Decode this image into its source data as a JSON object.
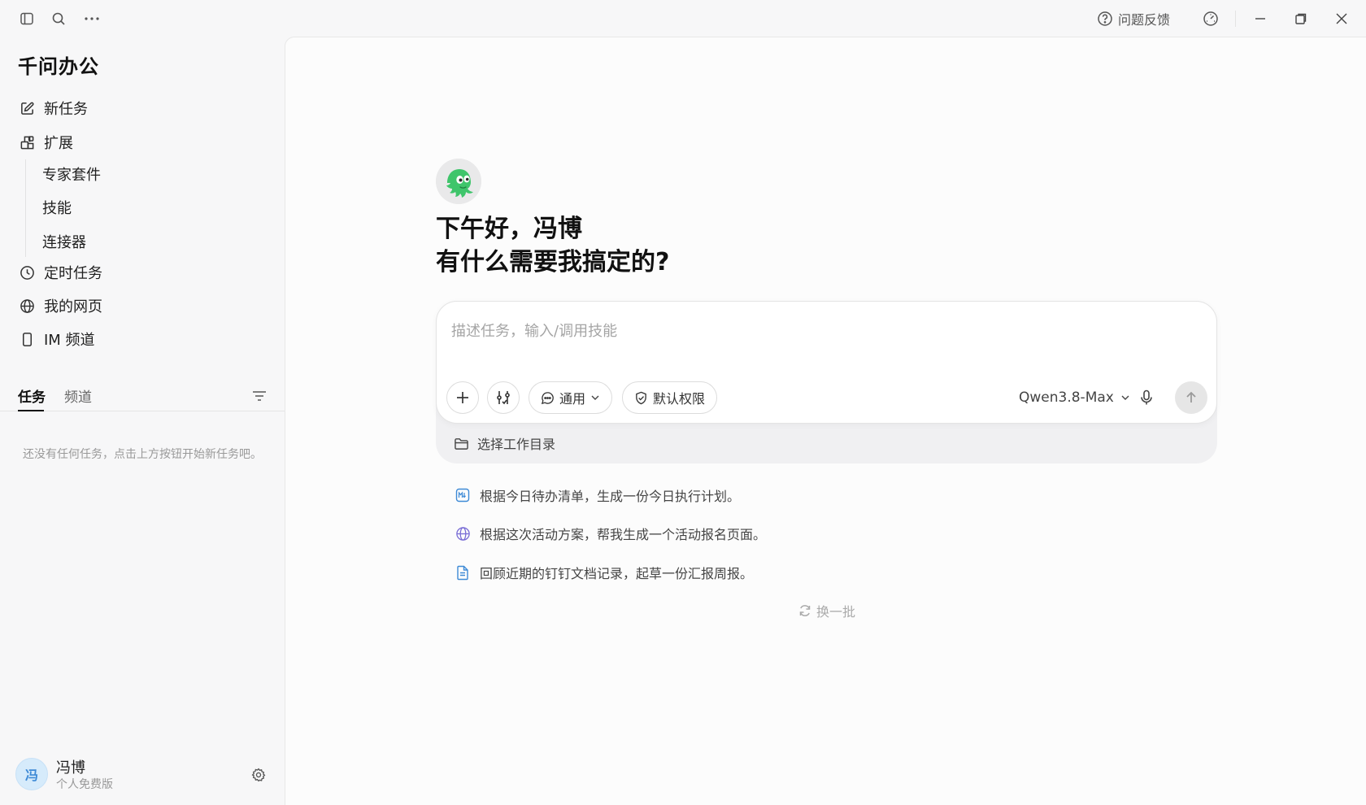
{
  "titlebar": {
    "feedback_label": "问题反馈",
    "icons": [
      "sidebar-toggle-icon",
      "search-icon",
      "more-icon",
      "feedback-help-icon",
      "gauge-icon",
      "minimize-icon",
      "restore-icon",
      "close-icon"
    ]
  },
  "sidebar": {
    "app_title": "千问办公",
    "nav": {
      "new_task": "新任务",
      "extensions": "扩展",
      "expert_kits": "专家套件",
      "skills": "技能",
      "connectors": "连接器",
      "scheduled_tasks": "定时任务",
      "my_pages": "我的网页",
      "im_channels": "IM 频道"
    },
    "tabs": {
      "tasks": "任务",
      "channels": "频道"
    },
    "empty_text": "还没有任何任务，点击上方按钮开始新任务吧。",
    "user": {
      "avatar_text": "冯",
      "name": "冯博",
      "plan": "个人免费版"
    }
  },
  "main": {
    "greeting_line1": "下午好，冯博",
    "greeting_line2": "有什么需要我搞定的?",
    "composer": {
      "placeholder": "描述任务，输入/调用技能",
      "mode_label": "通用",
      "permission_label": "默认权限",
      "model_label": "Qwen3.8-Max"
    },
    "workdir_label": "选择工作目录",
    "suggestions": [
      {
        "text": "根据今日待办清单，生成一份今日执行计划。",
        "icon": "markdown-icon"
      },
      {
        "text": "根据这次活动方案，帮我生成一个活动报名页面。",
        "icon": "globe-icon"
      },
      {
        "text": "回顾近期的钉钉文档记录，起草一份汇报周报。",
        "icon": "document-icon"
      }
    ],
    "refresh_label": "换一批"
  },
  "colors": {
    "accent_blue": "#3e8ad6",
    "globe_purple": "#7b6fd6",
    "mascot_green": "#3fc56b"
  }
}
